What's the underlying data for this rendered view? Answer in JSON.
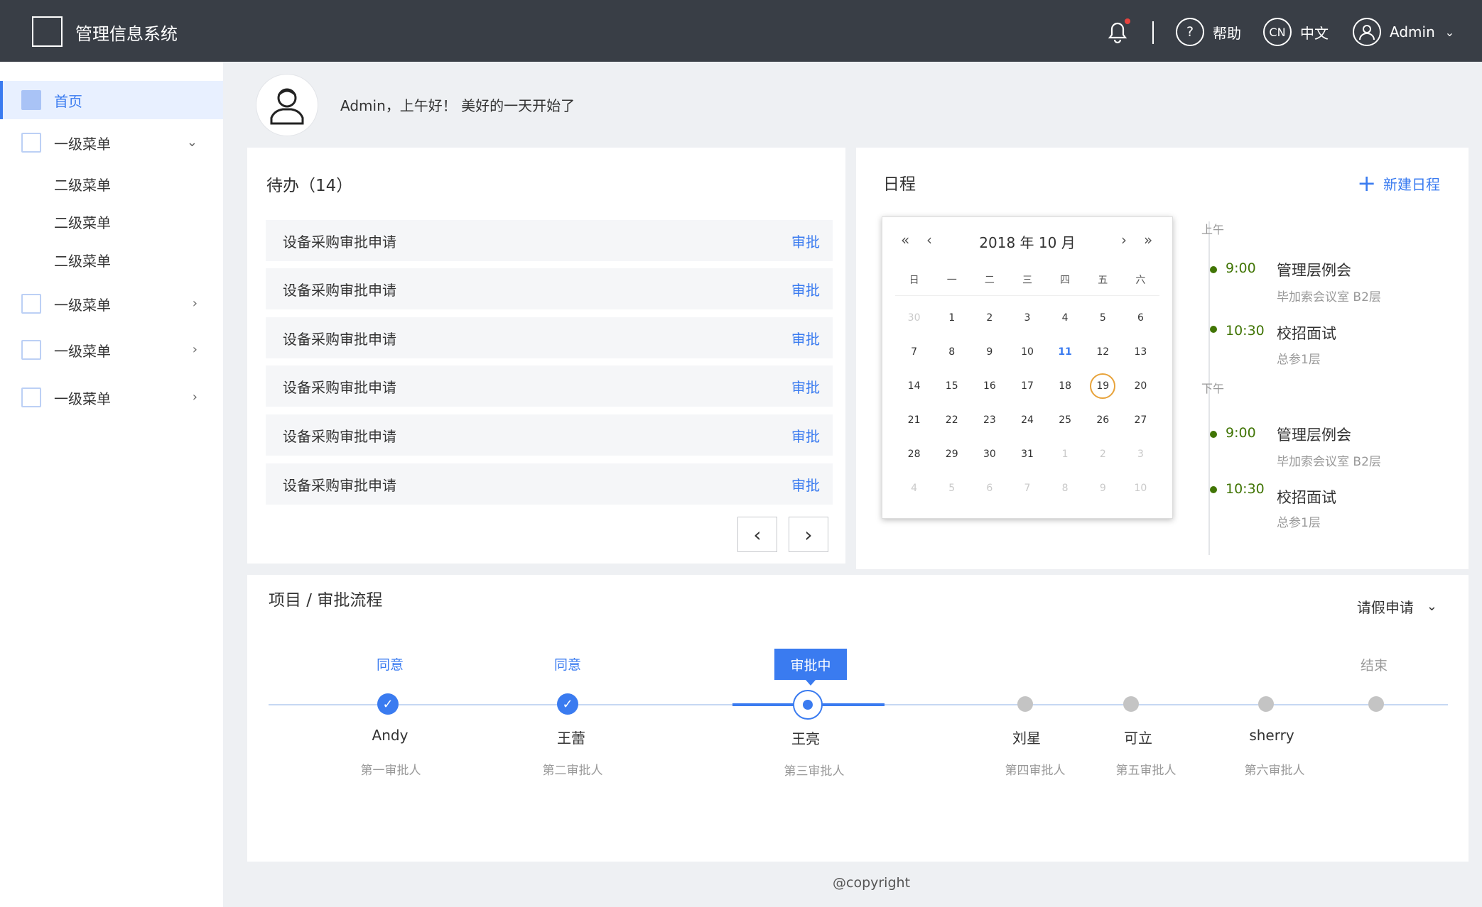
{
  "header": {
    "app_title": "管理信息系统",
    "help_label": "帮助",
    "help_icon_glyph": "?",
    "lang_label": "中文",
    "lang_icon_text": "CN",
    "user_label": "Admin"
  },
  "sidebar": {
    "items": [
      {
        "label": "首页"
      },
      {
        "label": "一级菜单"
      },
      {
        "label": "二级菜单"
      },
      {
        "label": "二级菜单"
      },
      {
        "label": "二级菜单"
      },
      {
        "label": "一级菜单"
      },
      {
        "label": "一级菜单"
      },
      {
        "label": "一级菜单"
      }
    ]
  },
  "greeting": {
    "text": "Admin，上午好！ 美好的一天开始了"
  },
  "todo": {
    "title": "待办（14）",
    "rows": [
      {
        "label": "设备采购审批申请",
        "action": "审批"
      },
      {
        "label": "设备采购审批申请",
        "action": "审批"
      },
      {
        "label": "设备采购审批申请",
        "action": "审批"
      },
      {
        "label": "设备采购审批申请",
        "action": "审批"
      },
      {
        "label": "设备采购审批申请",
        "action": "审批"
      },
      {
        "label": "设备采购审批申请",
        "action": "审批"
      }
    ],
    "prev_label": "‹",
    "next_label": "›"
  },
  "schedule": {
    "title": "日程",
    "new_label": "新建日程",
    "calendar": {
      "title": "2018 年  10 月",
      "nav_prev_year": "«",
      "nav_prev_month": "‹",
      "nav_next_month": "›",
      "nav_next_year": "»",
      "weekdays": [
        "日",
        "一",
        "二",
        "三",
        "四",
        "五",
        "六"
      ],
      "days": [
        {
          "d": "30",
          "dim": true
        },
        {
          "d": "1"
        },
        {
          "d": "2"
        },
        {
          "d": "3"
        },
        {
          "d": "4"
        },
        {
          "d": "5"
        },
        {
          "d": "6"
        },
        {
          "d": "7"
        },
        {
          "d": "8"
        },
        {
          "d": "9"
        },
        {
          "d": "10"
        },
        {
          "d": "11",
          "today": true
        },
        {
          "d": "12"
        },
        {
          "d": "13"
        },
        {
          "d": "14"
        },
        {
          "d": "15"
        },
        {
          "d": "16"
        },
        {
          "d": "17"
        },
        {
          "d": "18"
        },
        {
          "d": "19",
          "selected": true
        },
        {
          "d": "20"
        },
        {
          "d": "21"
        },
        {
          "d": "22"
        },
        {
          "d": "23"
        },
        {
          "d": "24"
        },
        {
          "d": "25"
        },
        {
          "d": "26"
        },
        {
          "d": "27"
        },
        {
          "d": "28"
        },
        {
          "d": "29"
        },
        {
          "d": "30"
        },
        {
          "d": "31"
        },
        {
          "d": "1",
          "dim": true
        },
        {
          "d": "2",
          "dim": true
        },
        {
          "d": "3",
          "dim": true
        },
        {
          "d": "4",
          "dim": true
        },
        {
          "d": "5",
          "dim": true
        },
        {
          "d": "6",
          "dim": true
        },
        {
          "d": "7",
          "dim": true
        },
        {
          "d": "8",
          "dim": true
        },
        {
          "d": "9",
          "dim": true
        },
        {
          "d": "10",
          "dim": true
        }
      ]
    },
    "morning_label": "上午",
    "afternoon_label": "下午",
    "events": [
      {
        "time": "9:00",
        "title": "管理层例会",
        "location": "毕加索会议室 B2层"
      },
      {
        "time": "10:30",
        "title": "校招面试",
        "location": "总参1层"
      },
      {
        "time": "9:00",
        "title": "管理层例会",
        "location": "毕加索会议室 B2层"
      },
      {
        "time": "10:30",
        "title": "校招面试",
        "location": "总参1层"
      }
    ]
  },
  "flow": {
    "title": "项目 / 审批流程",
    "select_value": "请假申请",
    "current_bubble": "审批中",
    "end_label": "结束",
    "steps": [
      {
        "status": "同意",
        "name": "Andy",
        "role": "第一审批人"
      },
      {
        "status": "同意",
        "name": "王蕾",
        "role": "第二审批人"
      },
      {
        "status": "",
        "name": "王亮",
        "role": "第三审批人"
      },
      {
        "status": "",
        "name": "刘星",
        "role": "第四审批人"
      },
      {
        "status": "",
        "name": "可立",
        "role": "第五审批人"
      },
      {
        "status": "",
        "name": "sherry",
        "role": "第六审批人"
      }
    ]
  },
  "footer": {
    "text": "@copyright"
  },
  "colors": {
    "accent": "#3a7bf0",
    "topbar": "#393e46",
    "event_green": "#417505",
    "selected_ring": "#e8a33b"
  }
}
